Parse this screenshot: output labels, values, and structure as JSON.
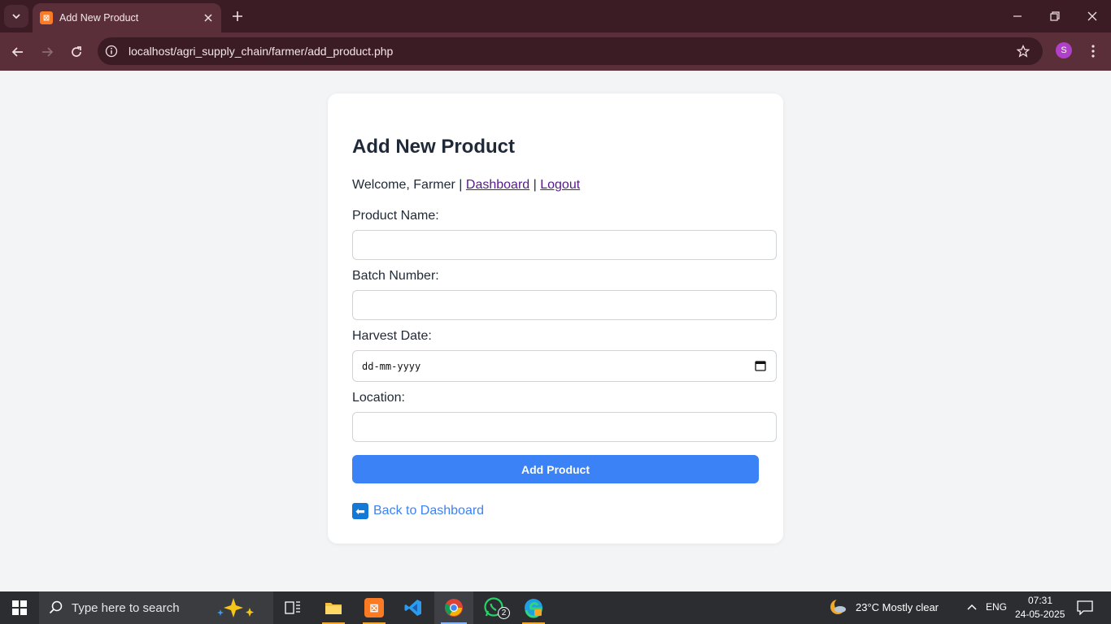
{
  "browser": {
    "tab_title": "Add New Product",
    "url": "localhost/agri_supply_chain/farmer/add_product.php",
    "profile_initial": "S"
  },
  "page": {
    "heading": "Add New Product",
    "welcome_prefix": "Welcome, Farmer | ",
    "dashboard_link": "Dashboard",
    "separator": " | ",
    "logout_link": "Logout",
    "fields": {
      "product_name_label": "Product Name:",
      "batch_number_label": "Batch Number:",
      "harvest_date_label": "Harvest Date:",
      "harvest_date_placeholder": "dd-mm-yyyy",
      "location_label": "Location:"
    },
    "submit_label": "Add Product",
    "back_label": "Back to Dashboard"
  },
  "taskbar": {
    "search_placeholder": "Type here to search",
    "weather": "23°C  Mostly clear",
    "language": "ENG",
    "time": "07:31",
    "date": "24-05-2025",
    "whatsapp_badge": "2"
  },
  "colors": {
    "accent": "#3b82f6",
    "browser_frame": "#5a2f3a"
  }
}
